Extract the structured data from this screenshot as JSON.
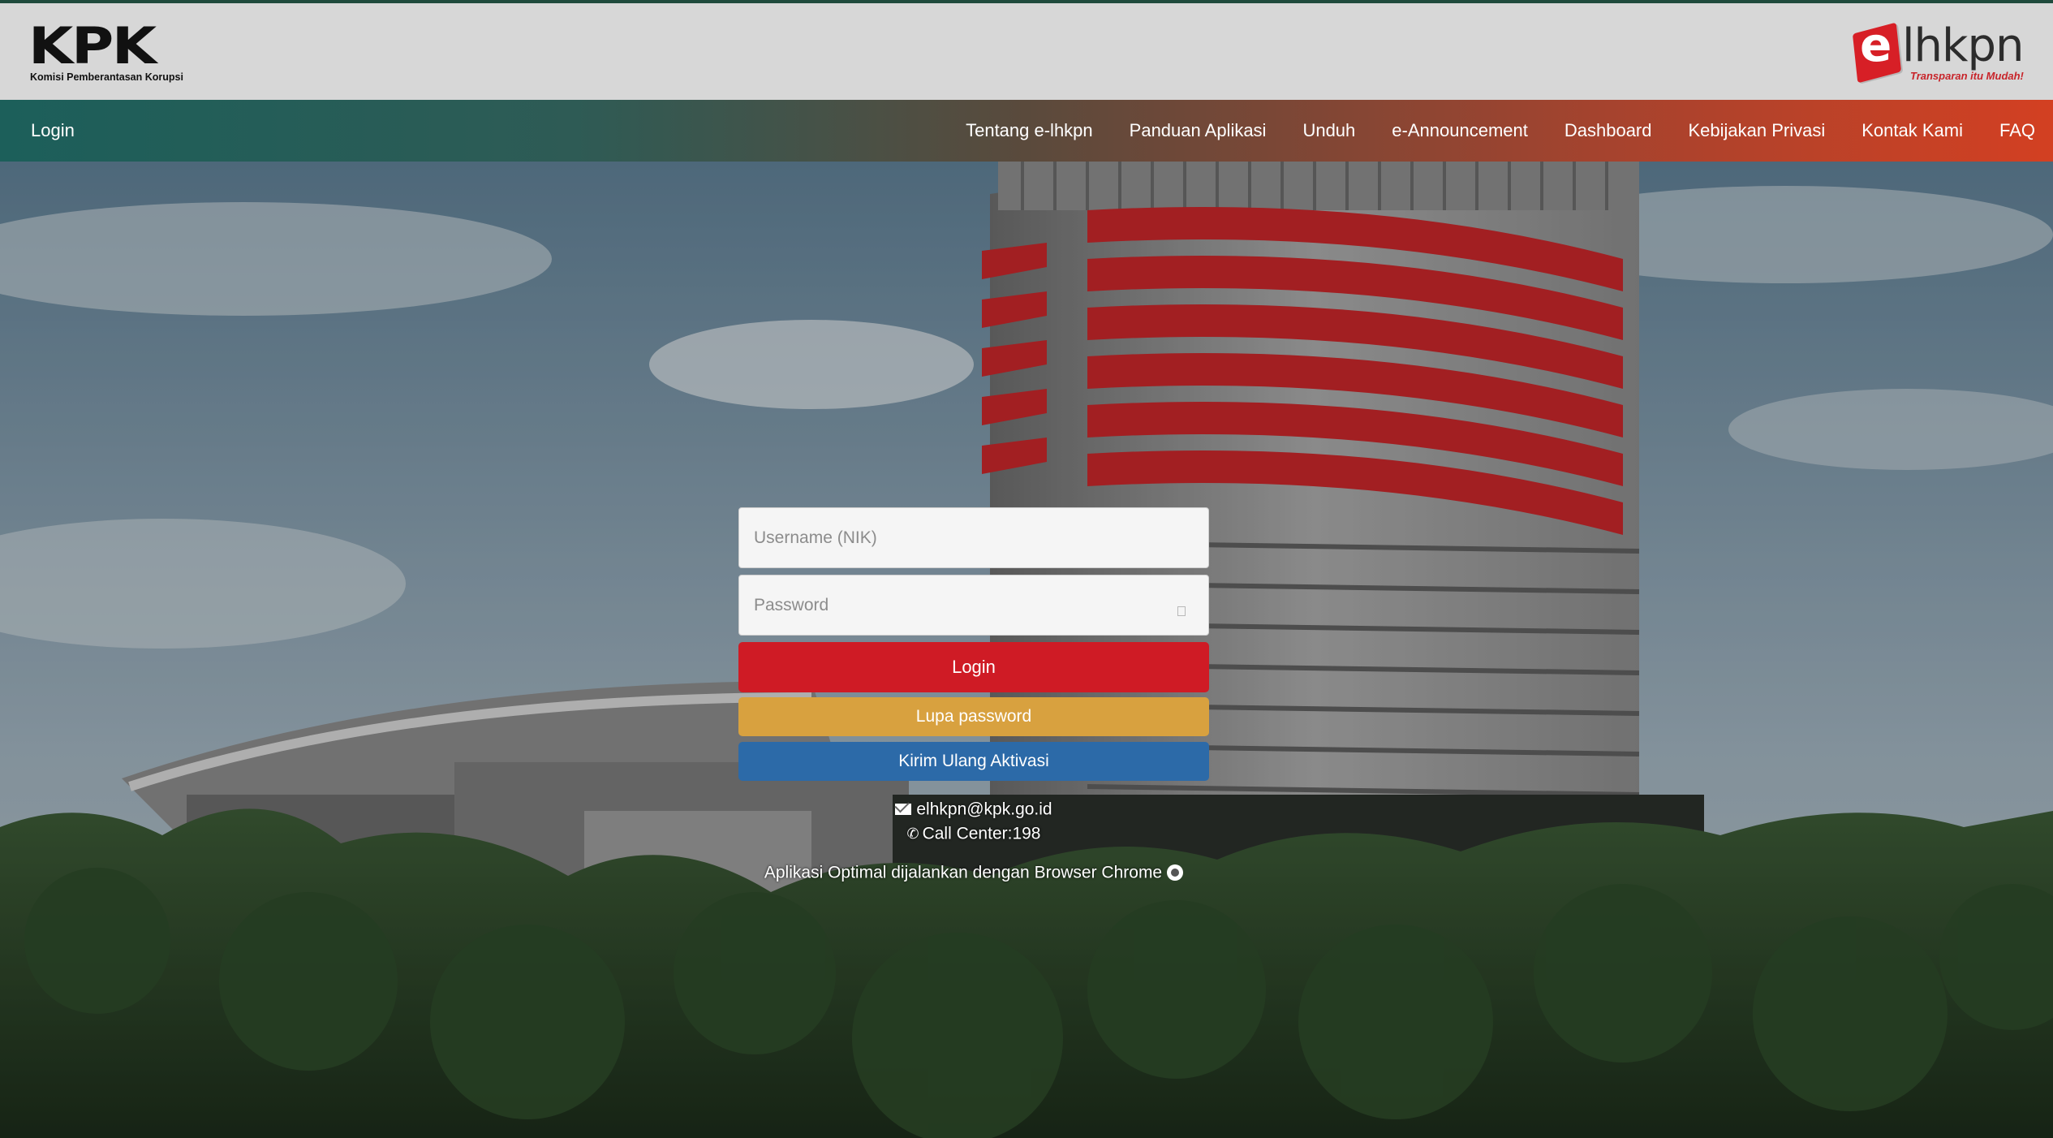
{
  "header": {
    "kpk_logo_text": "KPK",
    "kpk_subtitle": "Komisi Pemberantasan Korupsi",
    "elhkpn_e": "e",
    "elhkpn_text": "lhkpn",
    "elhkpn_tagline": "Transparan itu Mudah!"
  },
  "nav": {
    "left": "Login",
    "items": [
      "Tentang e-lhkpn",
      "Panduan Aplikasi",
      "Unduh",
      "e-Announcement",
      "Dashboard",
      "Kebijakan Privasi",
      "Kontak Kami",
      "FAQ"
    ]
  },
  "form": {
    "username_placeholder": "Username (NIK)",
    "password_placeholder": "Password",
    "login_label": "Login",
    "forgot_label": "Lupa password",
    "resend_label": "Kirim Ulang Aktivasi"
  },
  "info": {
    "email": "elhkpn@kpk.go.id",
    "call_center": "Call Center:198",
    "browser_note": "Aplikasi Optimal dijalankan dengan Browser Chrome"
  },
  "colors": {
    "login_button": "#cf1b25",
    "forgot_button": "#d8a13f",
    "resend_button": "#2c6aa8",
    "brand_red": "#d71f26"
  },
  "icons": [
    "mail-icon",
    "phone-icon",
    "chrome-icon",
    "eye-icon"
  ]
}
